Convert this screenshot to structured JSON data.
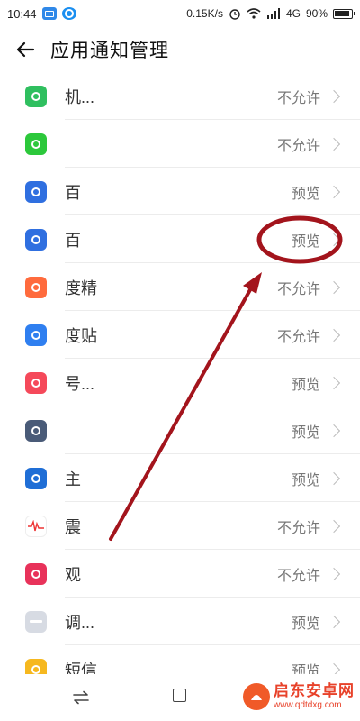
{
  "status_bar": {
    "time": "10:44",
    "speed": "0.15K/s",
    "network": "4G",
    "battery": "90%"
  },
  "header": {
    "title": "应用通知管理"
  },
  "apps": [
    {
      "name": "机...",
      "status": "不允许",
      "icon": "green-circle-plus-icon",
      "color": "#2fbf5f"
    },
    {
      "name": "",
      "status": "不允许",
      "icon": "iqiyi-icon",
      "color": "#2cc83b"
    },
    {
      "name": "百",
      "status": "预览",
      "icon": "baidu-paw-icon",
      "color": "#2f6fe0"
    },
    {
      "name": "百",
      "status": "预览",
      "icon": "baidu-du-icon",
      "color": "#2f6fe0"
    },
    {
      "name": "度精",
      "status": "不允许",
      "icon": "jing-icon",
      "color": "#ff6b3d"
    },
    {
      "name": "度贴",
      "status": "不允许",
      "icon": "tieba-icon",
      "color": "#2f7ff0"
    },
    {
      "name": "号...",
      "status": "预览",
      "icon": "contact-icon",
      "color": "#f5495a"
    },
    {
      "name": "",
      "status": "预览",
      "icon": "speaker-icon",
      "color": "#4a5b78"
    },
    {
      "name": "主",
      "status": "预览",
      "icon": "steering-wheel-icon",
      "color": "#1f6ed6"
    },
    {
      "name": "震",
      "status": "不允许",
      "icon": "seismic-icon",
      "color": "#ffffff"
    },
    {
      "name": "观",
      "status": "不允许",
      "icon": "tv-icon",
      "color": "#e8325a"
    },
    {
      "name": "调...",
      "status": "预览",
      "icon": "keyboard-icon",
      "color": "#d7dbe3"
    },
    {
      "name": "短信",
      "status": "预览",
      "icon": "sms-icon",
      "color": "#f6b81f"
    }
  ],
  "watermark": {
    "title": "启东安卓网",
    "url": "www.qdtdxg.com"
  },
  "colors": {
    "annotation": "#a3141c",
    "status_text": "#777777",
    "divider": "#ececec"
  }
}
